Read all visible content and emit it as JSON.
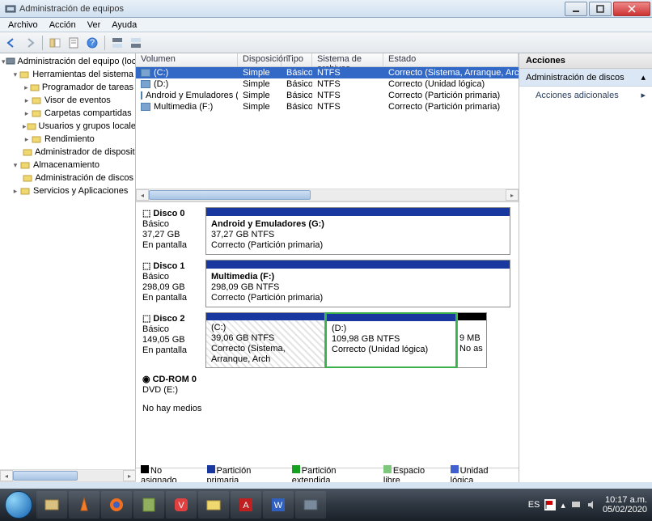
{
  "window": {
    "title": "Administración de equipos"
  },
  "menu": {
    "archivo": "Archivo",
    "accion": "Acción",
    "ver": "Ver",
    "ayuda": "Ayuda"
  },
  "tree": {
    "root": "Administración del equipo (local)",
    "items": [
      {
        "label": "Herramientas del sistema",
        "lvl": 1,
        "exp": "▾"
      },
      {
        "label": "Programador de tareas",
        "lvl": 2,
        "exp": "▸"
      },
      {
        "label": "Visor de eventos",
        "lvl": 2,
        "exp": "▸"
      },
      {
        "label": "Carpetas compartidas",
        "lvl": 2,
        "exp": "▸"
      },
      {
        "label": "Usuarios y grupos locales",
        "lvl": 2,
        "exp": "▸"
      },
      {
        "label": "Rendimiento",
        "lvl": 2,
        "exp": "▸"
      },
      {
        "label": "Administrador de dispositivos",
        "lvl": 2,
        "exp": " "
      },
      {
        "label": "Almacenamiento",
        "lvl": 1,
        "exp": "▾"
      },
      {
        "label": "Administración de discos",
        "lvl": 2,
        "exp": " "
      },
      {
        "label": "Servicios y Aplicaciones",
        "lvl": 1,
        "exp": "▸"
      }
    ]
  },
  "grid": {
    "cols": {
      "vol": "Volumen",
      "disp": "Disposición",
      "tipo": "Tipo",
      "fs": "Sistema de archivos",
      "estado": "Estado"
    },
    "rows": [
      {
        "vol": "(C:)",
        "disp": "Simple",
        "tipo": "Básico",
        "fs": "NTFS",
        "estado": "Correcto (Sistema, Arranque, Archivo d",
        "sel": true
      },
      {
        "vol": "(D:)",
        "disp": "Simple",
        "tipo": "Básico",
        "fs": "NTFS",
        "estado": "Correcto (Unidad lógica)"
      },
      {
        "vol": "Android y Emuladores (G:)",
        "disp": "Simple",
        "tipo": "Básico",
        "fs": "NTFS",
        "estado": "Correcto (Partición primaria)"
      },
      {
        "vol": "Multimedia (F:)",
        "disp": "Simple",
        "tipo": "Básico",
        "fs": "NTFS",
        "estado": "Correcto (Partición primaria)"
      }
    ]
  },
  "disks": {
    "d0": {
      "title": "Disco 0",
      "type": "Básico",
      "size": "37,27 GB",
      "state": "En pantalla",
      "part": {
        "name": "Android y Emuladores  (G:)",
        "size": "37,27 GB NTFS",
        "status": "Correcto (Partición primaria)"
      }
    },
    "d1": {
      "title": "Disco 1",
      "type": "Básico",
      "size": "298,09 GB",
      "state": "En pantalla",
      "part": {
        "name": "Multimedia  (F:)",
        "size": "298,09 GB NTFS",
        "status": "Correcto (Partición primaria)"
      }
    },
    "d2": {
      "title": "Disco 2",
      "type": "Básico",
      "size": "149,05 GB",
      "state": "En pantalla",
      "p1": {
        "name": "(C:)",
        "size": "39,06 GB NTFS",
        "status": "Correcto (Sistema, Arranque, Arch"
      },
      "p2": {
        "name": "(D:)",
        "size": "109,98 GB NTFS",
        "status": "Correcto (Unidad lógica)"
      },
      "p3": {
        "size": "9 MB",
        "status": "No as"
      }
    },
    "cd": {
      "title": "CD-ROM 0",
      "type": "DVD (E:)",
      "msg": "No hay medios"
    }
  },
  "legend": {
    "unalloc": "No asignado",
    "primary": "Partición primaria",
    "extended": "Partición extendida",
    "free": "Espacio libre",
    "logical": "Unidad lógica"
  },
  "actions": {
    "hdr": "Acciones",
    "sel": "Administración de discos",
    "more": "Acciones adicionales"
  },
  "tray": {
    "lang": "ES",
    "time": "10:17 a.m.",
    "date": "05/02/2020"
  }
}
